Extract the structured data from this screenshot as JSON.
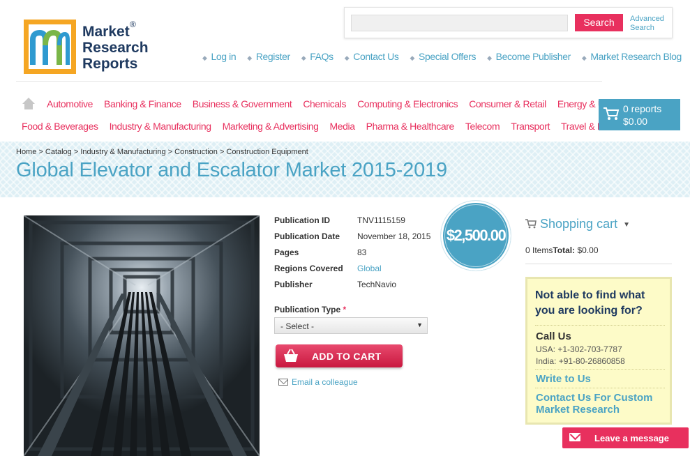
{
  "logo": {
    "line1": "Market",
    "line2": "Research",
    "line3": "Reports",
    "registered": "®"
  },
  "search": {
    "placeholder": "",
    "button": "Search",
    "advanced": "Advanced Search"
  },
  "top_links": [
    "Log in",
    "Register",
    "FAQs",
    "Contact Us",
    "Special Offers",
    "Become Publisher",
    "Market Research Blog"
  ],
  "categories_row1": [
    "Automotive",
    "Banking & Finance",
    "Business & Government",
    "Chemicals",
    "Computing & Electronics",
    "Consumer & Retail",
    "Energy & Utilities"
  ],
  "categories_row2": [
    "Food & Beverages",
    "Industry & Manufacturing",
    "Marketing & Advertising",
    "Media",
    "Pharma & Healthcare",
    "Telecom",
    "Transport",
    "Travel & Leisure"
  ],
  "cart": {
    "count": "0 reports",
    "total": "$0.00"
  },
  "breadcrumb": "Home > Catalog > Industry & Manufacturing > Construction > Construction Equipment",
  "title": "Global Elevator and Escalator Market 2015-2019",
  "details": {
    "pub_id_label": "Publication ID",
    "pub_id": "TNV1115159",
    "pub_date_label": "Publication Date",
    "pub_date": "November 18, 2015",
    "pages_label": "Pages",
    "pages": "83",
    "regions_label": "Regions Covered",
    "regions": "Global",
    "publisher_label": "Publisher",
    "publisher": "TechNavio"
  },
  "price": "$2,500.00",
  "pub_type": {
    "label": "Publication Type",
    "required": "*",
    "selected": "- Select -"
  },
  "add_to_cart": "ADD TO CART",
  "email_colleague": "Email a colleague",
  "shopping_cart": {
    "title": "Shopping cart",
    "items": "0 Items",
    "total_label": "Total:",
    "total": "$0.00"
  },
  "help": {
    "question": "Not able to find what you are looking for?",
    "call_us": "Call Us",
    "usa": "USA: +1-302-703-7787",
    "india": "India: +91-80-26860858",
    "write": "Write to Us",
    "custom": "Contact Us For Custom Market Research"
  },
  "leave_message": "Leave a message",
  "colors": {
    "accent_pink": "#e8305e",
    "accent_blue": "#4aa3c4",
    "logo_orange": "#f5a623",
    "navy": "#1f3a60"
  }
}
